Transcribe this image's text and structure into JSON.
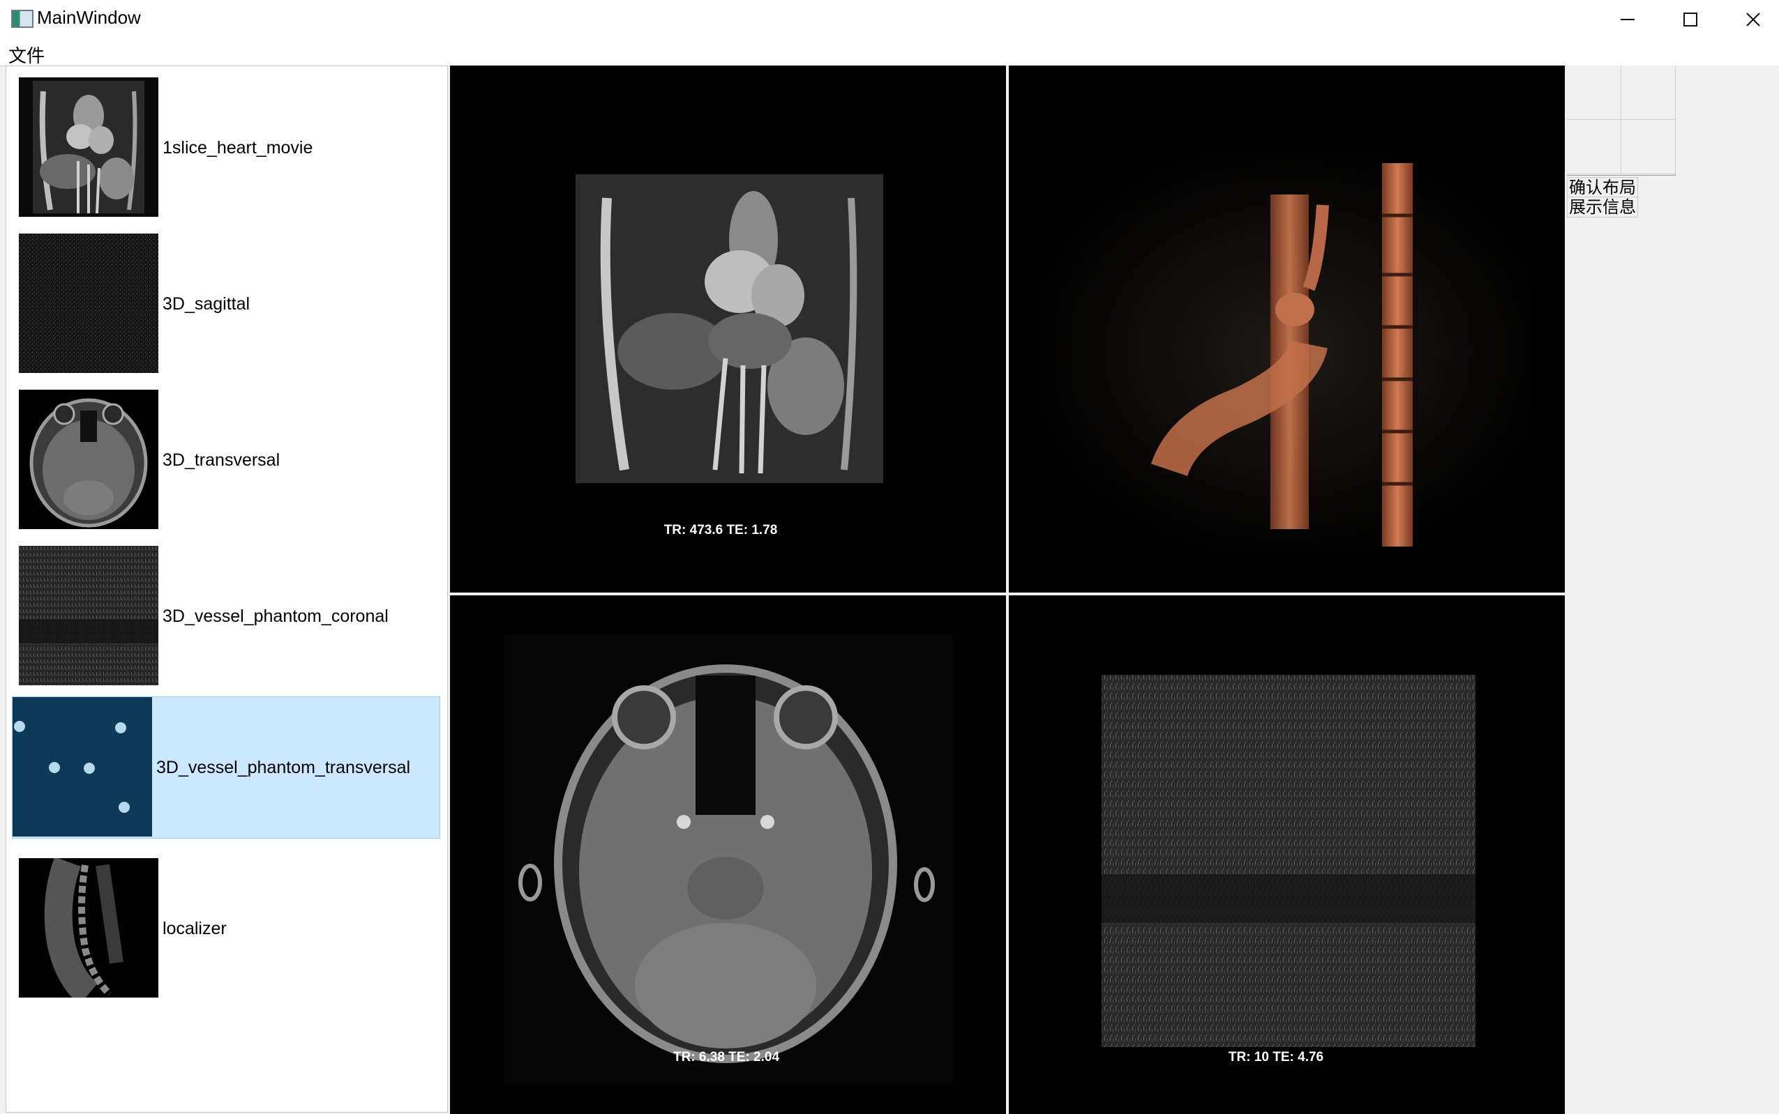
{
  "window": {
    "title": "MainWindow"
  },
  "menu": {
    "file": "文件"
  },
  "sidebar": {
    "items": [
      {
        "label": "1slice_heart_movie",
        "thumb": "heart-coronal-thumbnail"
      },
      {
        "label": "3D_sagittal",
        "thumb": "noise-thumbnail"
      },
      {
        "label": "3D_transversal",
        "thumb": "brain-axial-thumbnail"
      },
      {
        "label": "3D_vessel_phantom_coronal",
        "thumb": "vessel-coronal-thumbnail"
      },
      {
        "label": "3D_vessel_phantom_transversal",
        "thumb": "vessel-transversal-thumbnail",
        "selected": true
      },
      {
        "label": "localizer",
        "thumb": "spine-sagittal-thumbnail"
      }
    ]
  },
  "viewer": {
    "panes": [
      {
        "info": "TR: 473.6 TE: 1.78",
        "image": "heart-coronal-mri"
      },
      {
        "info": "",
        "image": "vessel-phantom-3d-render"
      },
      {
        "info": "TR: 6.38 TE: 2.04",
        "image": "brain-axial-mri"
      },
      {
        "info": "TR: 10 TE: 4.76",
        "image": "vessel-phantom-coronal-slice"
      }
    ]
  },
  "panel": {
    "confirm_layout": "确认布局",
    "show_info": "展示信息"
  },
  "colors": {
    "selection_bg": "#cce8ff",
    "selection_border": "#99d1ff",
    "viewer_bg": "#000000",
    "phantom_color": "#c8704a"
  }
}
